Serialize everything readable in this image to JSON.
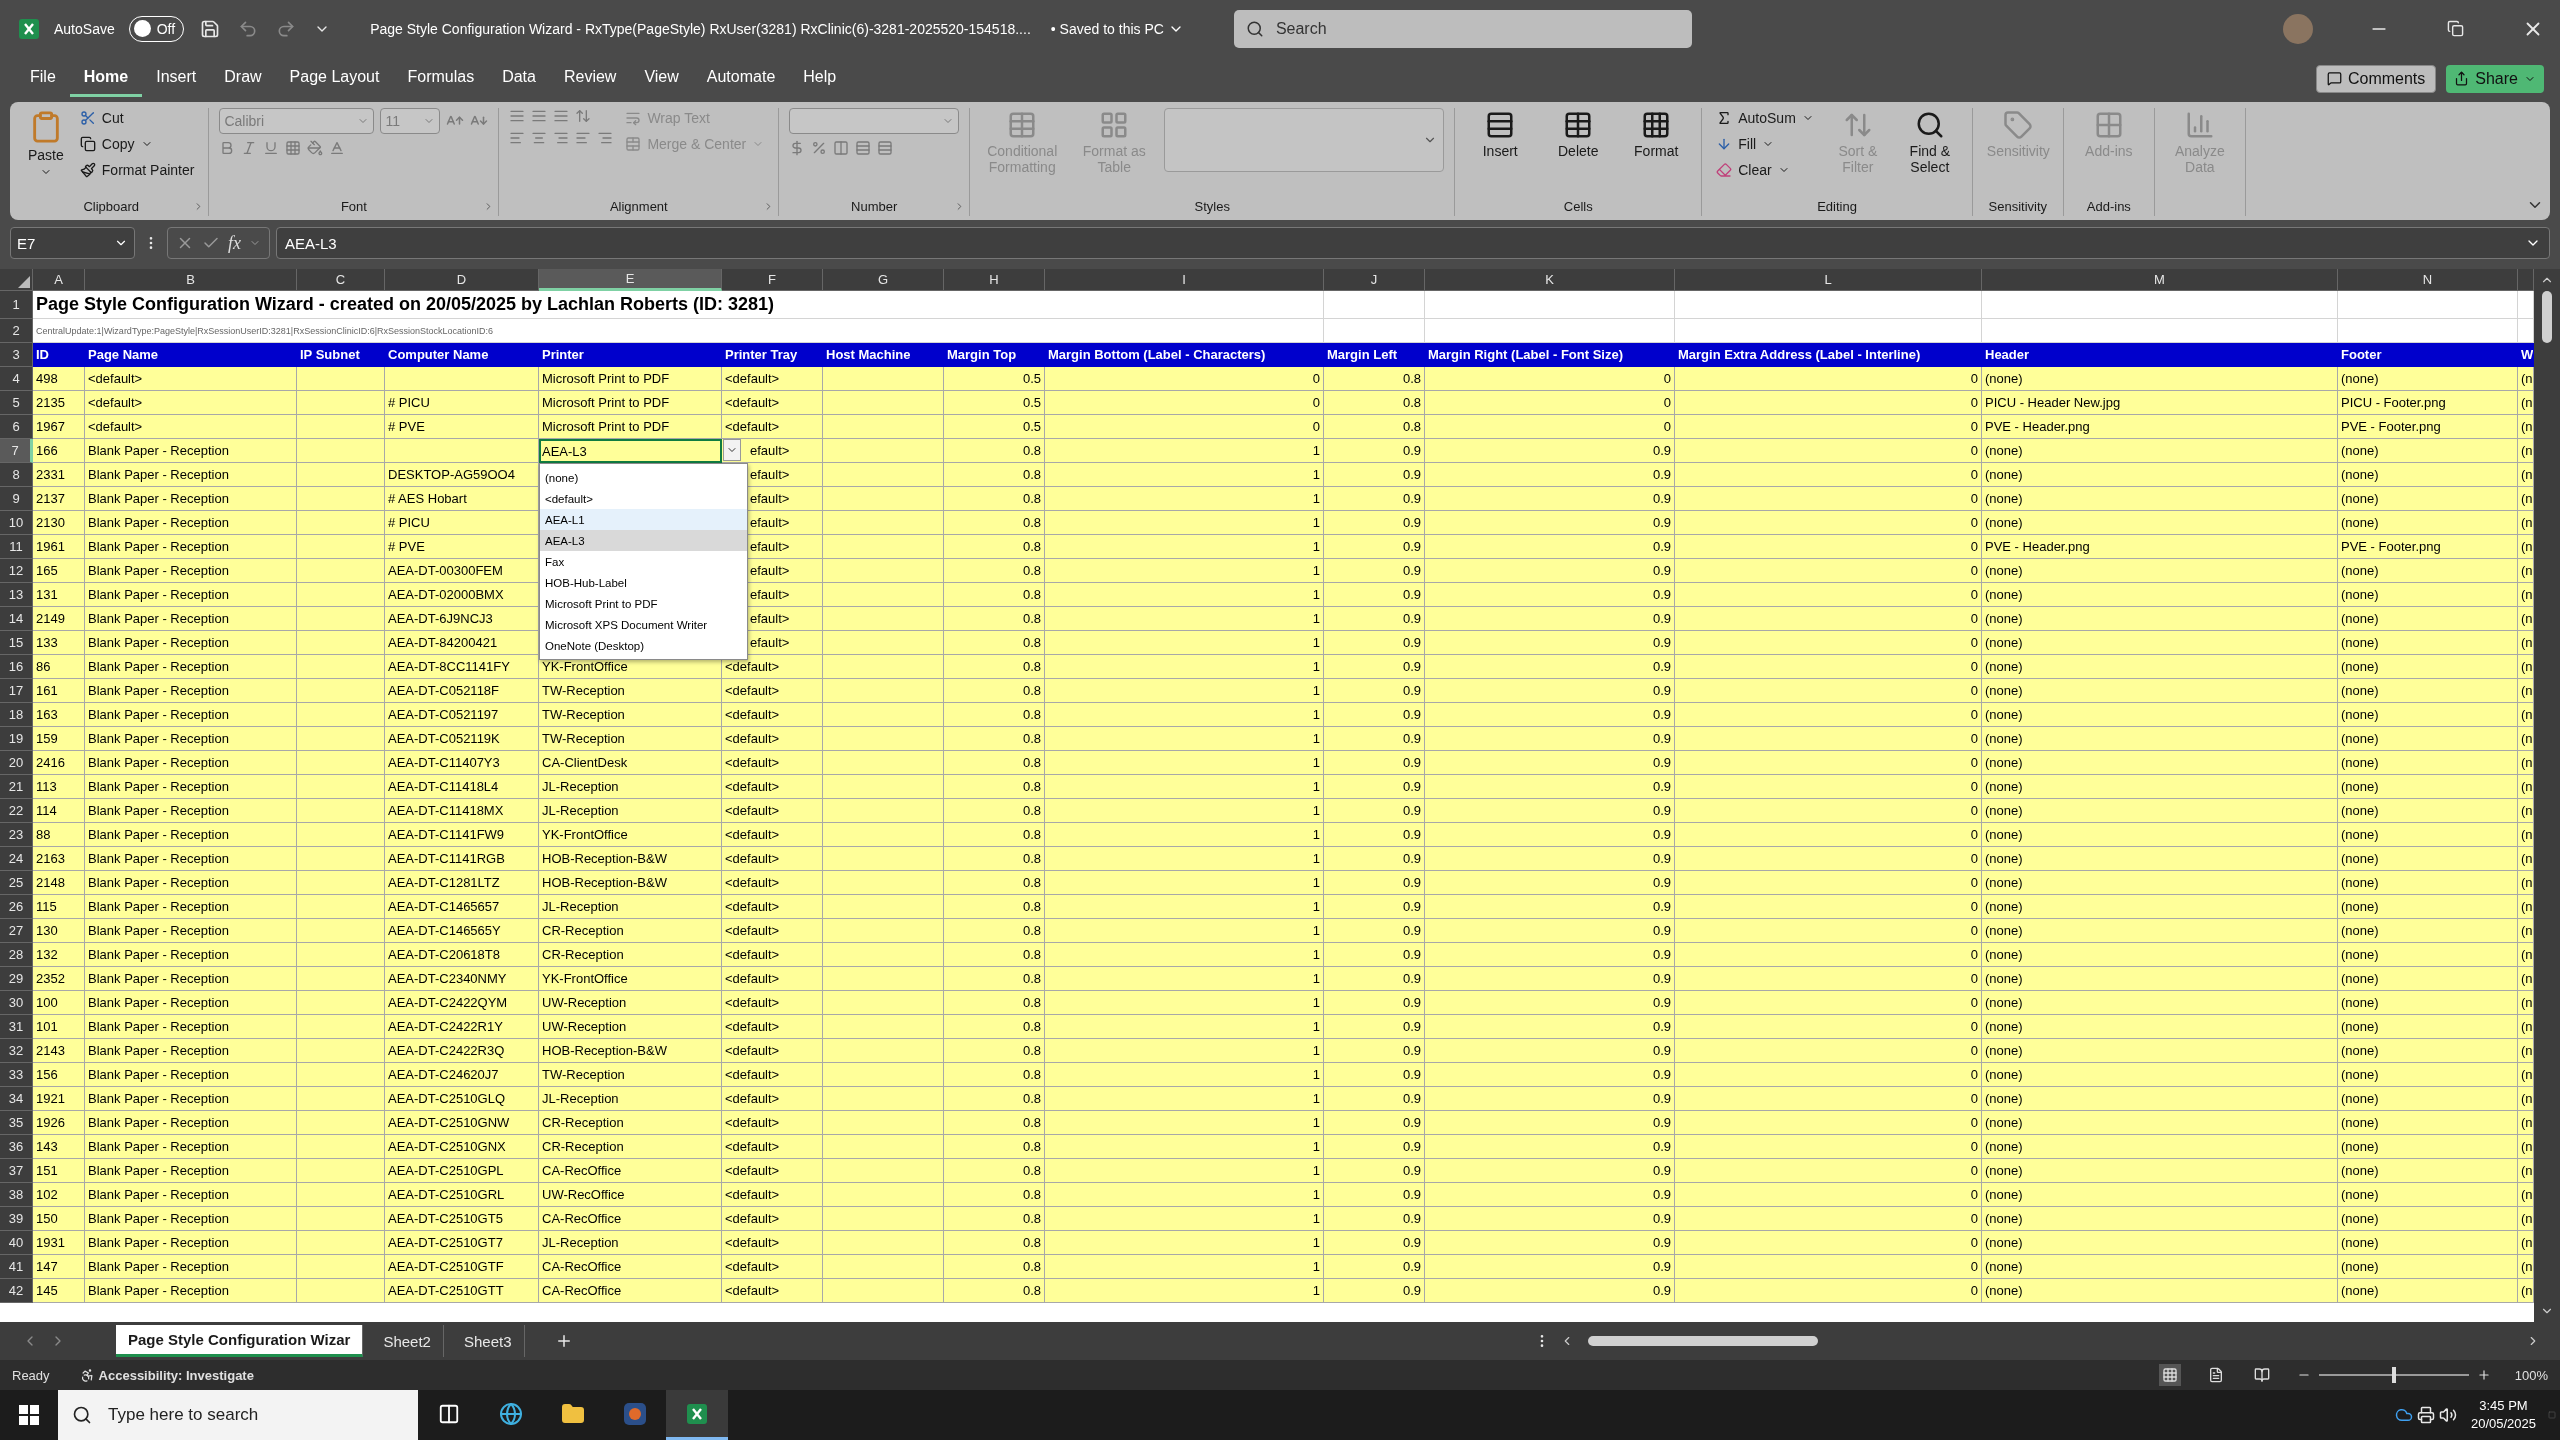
{
  "titlebar": {
    "autosave_label": "AutoSave",
    "autosave": {
      "on": false,
      "label": "Off"
    },
    "title": "Page Style Configuration Wizard - RxType(PageStyle) RxUser(3281) RxClinic(6)-3281-2025520-154518....",
    "save_status": "• Saved to this PC",
    "search": {
      "placeholder": "Search"
    }
  },
  "menu": {
    "tabs": [
      {
        "label": "File",
        "selected": false
      },
      {
        "label": "Home",
        "selected": true
      },
      {
        "label": "Insert",
        "selected": false
      },
      {
        "label": "Draw",
        "selected": false
      },
      {
        "label": "Page Layout",
        "selected": false
      },
      {
        "label": "Formulas",
        "selected": false
      },
      {
        "label": "Data",
        "selected": false
      },
      {
        "label": "Review",
        "selected": false
      },
      {
        "label": "View",
        "selected": false
      },
      {
        "label": "Automate",
        "selected": false
      },
      {
        "label": "Help",
        "selected": false
      }
    ],
    "comments": "Comments",
    "share": "Share"
  },
  "ribbon": {
    "groups": [
      {
        "kind": "clipboard",
        "label": "Clipboard",
        "launcher": true,
        "items": [
          {
            "label": "Paste",
            "disabled": false
          },
          {
            "label": "Cut",
            "disabled": false
          },
          {
            "label": "Copy",
            "disabled": false
          },
          {
            "label": "Format Painter",
            "disabled": false
          }
        ]
      },
      {
        "kind": "font",
        "label": "Font",
        "launcher": true,
        "font_name": "Calibri",
        "font_size": "11"
      },
      {
        "kind": "alignment",
        "label": "Alignment",
        "launcher": true,
        "items": [
          {
            "label": "Wrap Text",
            "disabled": true
          },
          {
            "label": "Merge & Center",
            "disabled": true
          }
        ]
      },
      {
        "kind": "number",
        "label": "Number",
        "launcher": true
      },
      {
        "kind": "styles",
        "label": "Styles",
        "items": [
          {
            "label": "Conditional Formatting",
            "disabled": true
          },
          {
            "label": "Format as Table",
            "disabled": true
          }
        ]
      },
      {
        "kind": "large",
        "label": "Cells",
        "items": [
          {
            "label": "Insert",
            "disabled": false
          },
          {
            "label": "Delete",
            "disabled": false
          },
          {
            "label": "Format",
            "disabled": false
          }
        ]
      },
      {
        "kind": "editing",
        "label": "Editing",
        "items": [
          {
            "label": "AutoSum",
            "disabled": false
          },
          {
            "label": "Fill",
            "disabled": false
          },
          {
            "label": "Clear",
            "disabled": false
          },
          {
            "label": "Sort & Filter",
            "disabled": true
          },
          {
            "label": "Find & Select",
            "disabled": false
          }
        ]
      },
      {
        "kind": "large",
        "label": "Sensitivity",
        "items": [
          {
            "label": "Sensitivity",
            "disabled": true
          }
        ]
      },
      {
        "kind": "large",
        "label": "Add-ins",
        "items": [
          {
            "label": "Add-ins",
            "disabled": true
          }
        ]
      },
      {
        "kind": "large",
        "items": [
          {
            "label": "Analyze Data",
            "disabled": true
          }
        ]
      }
    ]
  },
  "formula_bar": {
    "name_box": "E7",
    "function_label": "fx",
    "value": "AEA-L3"
  },
  "sheet": {
    "columns": [
      {
        "letter": "A",
        "header": "ID",
        "kind": "text",
        "selected": false
      },
      {
        "letter": "B",
        "header": "Page Name",
        "kind": "text",
        "selected": false
      },
      {
        "letter": "C",
        "header": "IP Subnet",
        "kind": "text",
        "selected": false
      },
      {
        "letter": "D",
        "header": "Computer Name",
        "kind": "text",
        "selected": false
      },
      {
        "letter": "E",
        "header": "Printer",
        "kind": "text",
        "selected": true
      },
      {
        "letter": "F",
        "header": "Printer Tray",
        "kind": "text",
        "selected": false
      },
      {
        "letter": "G",
        "header": "Host Machine",
        "kind": "text",
        "selected": false
      },
      {
        "letter": "H",
        "header": "Margin Top",
        "kind": "number",
        "selected": false
      },
      {
        "letter": "I",
        "header": "Margin Bottom (Label - Characters)",
        "kind": "number",
        "selected": false
      },
      {
        "letter": "J",
        "header": "Margin Left",
        "kind": "number",
        "selected": false
      },
      {
        "letter": "K",
        "header": "Margin Right (Label - Font Size)",
        "kind": "number",
        "selected": false
      },
      {
        "letter": "L",
        "header": "Margin Extra Address (Label - Interline)",
        "kind": "number",
        "selected": false
      },
      {
        "letter": "M",
        "header": "Header",
        "kind": "text",
        "selected": false
      },
      {
        "letter": "N",
        "header": "Footer",
        "kind": "text",
        "selected": false
      },
      {
        "header": "W",
        "kind": "text",
        "selected": false
      }
    ],
    "title_row": {
      "number": "1",
      "text": "Page Style Configuration Wizard - created on 20/05/2025 by Lachlan Roberts (ID: 3281)"
    },
    "info_row": {
      "number": "2",
      "text": "CentralUpdate:1|WizardType:PageStyle|RxSessionUserID:3281|RxSessionClinicID:6|RxSessionStockLocationID:6"
    },
    "header_row_number": "3",
    "rows": [
      {
        "number": "4",
        "selected": false,
        "cells": [
          "498",
          "<default>",
          null,
          null,
          "Microsoft Print to PDF",
          "<default>",
          null,
          "0.5",
          "0",
          "0.8",
          "0",
          "0",
          "(none)",
          "(none)",
          "(n"
        ]
      },
      {
        "number": "5",
        "selected": false,
        "cells": [
          "2135",
          "<default>",
          null,
          "# PICU",
          "Microsoft Print to PDF",
          "<default>",
          null,
          "0.5",
          "0",
          "0.8",
          "0",
          "0",
          "PICU - Header New.jpg",
          "PICU - Footer.png",
          "(n"
        ]
      },
      {
        "number": "6",
        "selected": false,
        "cells": [
          "1967",
          "<default>",
          null,
          "# PVE",
          "Microsoft Print to PDF",
          "<default>",
          null,
          "0.5",
          "0",
          "0.8",
          "0",
          "0",
          "PVE - Header.png",
          "PVE - Footer.png",
          "(n"
        ]
      },
      {
        "number": "7",
        "selected": true,
        "cells": [
          "166",
          "Blank Paper - Reception",
          null,
          null,
          "AEA-L3",
          "efault>",
          null,
          "0.8",
          "1",
          "0.9",
          "0.9",
          "0",
          "(none)",
          "(none)",
          "(n"
        ]
      },
      {
        "number": "8",
        "selected": false,
        "cells": [
          "2331",
          "Blank Paper - Reception",
          null,
          "DESKTOP-AG59OO4",
          null,
          "efault>",
          null,
          "0.8",
          "1",
          "0.9",
          "0.9",
          "0",
          "(none)",
          "(none)",
          "(n"
        ]
      },
      {
        "number": "9",
        "selected": false,
        "cells": [
          "2137",
          "Blank Paper - Reception",
          null,
          "# AES Hobart",
          null,
          "efault>",
          null,
          "0.8",
          "1",
          "0.9",
          "0.9",
          "0",
          "(none)",
          "(none)",
          "(n"
        ]
      },
      {
        "number": "10",
        "selected": false,
        "cells": [
          "2130",
          "Blank Paper - Reception",
          null,
          "# PICU",
          null,
          "efault>",
          null,
          "0.8",
          "1",
          "0.9",
          "0.9",
          "0",
          "(none)",
          "(none)",
          "(n"
        ]
      },
      {
        "number": "11",
        "selected": false,
        "cells": [
          "1961",
          "Blank Paper - Reception",
          null,
          "# PVE",
          null,
          "efault>",
          null,
          "0.8",
          "1",
          "0.9",
          "0.9",
          "0",
          "PVE - Header.png",
          "PVE - Footer.png",
          "(n"
        ]
      },
      {
        "number": "12",
        "selected": false,
        "cells": [
          "165",
          "Blank Paper - Reception",
          null,
          "AEA-DT-00300FEM",
          null,
          "efault>",
          null,
          "0.8",
          "1",
          "0.9",
          "0.9",
          "0",
          "(none)",
          "(none)",
          "(n"
        ]
      },
      {
        "number": "13",
        "selected": false,
        "cells": [
          "131",
          "Blank Paper - Reception",
          null,
          "AEA-DT-02000BMX",
          null,
          "efault>",
          null,
          "0.8",
          "1",
          "0.9",
          "0.9",
          "0",
          "(none)",
          "(none)",
          "(n"
        ]
      },
      {
        "number": "14",
        "selected": false,
        "cells": [
          "2149",
          "Blank Paper - Reception",
          null,
          "AEA-DT-6J9NCJ3",
          null,
          "efault>",
          null,
          "0.8",
          "1",
          "0.9",
          "0.9",
          "0",
          "(none)",
          "(none)",
          "(n"
        ]
      },
      {
        "number": "15",
        "selected": false,
        "cells": [
          "133",
          "Blank Paper - Reception",
          null,
          "AEA-DT-84200421",
          null,
          "efault>",
          null,
          "0.8",
          "1",
          "0.9",
          "0.9",
          "0",
          "(none)",
          "(none)",
          "(n"
        ]
      },
      {
        "number": "16",
        "selected": false,
        "cells": [
          "86",
          "Blank Paper - Reception",
          null,
          "AEA-DT-8CC1141FY",
          "YK-FrontOffice",
          "<default>",
          null,
          "0.8",
          "1",
          "0.9",
          "0.9",
          "0",
          "(none)",
          "(none)",
          "(n"
        ]
      },
      {
        "number": "17",
        "selected": false,
        "cells": [
          "161",
          "Blank Paper - Reception",
          null,
          "AEA-DT-C052118F",
          "TW-Reception",
          "<default>",
          null,
          "0.8",
          "1",
          "0.9",
          "0.9",
          "0",
          "(none)",
          "(none)",
          "(n"
        ]
      },
      {
        "number": "18",
        "selected": false,
        "cells": [
          "163",
          "Blank Paper - Reception",
          null,
          "AEA-DT-C0521197",
          "TW-Reception",
          "<default>",
          null,
          "0.8",
          "1",
          "0.9",
          "0.9",
          "0",
          "(none)",
          "(none)",
          "(n"
        ]
      },
      {
        "number": "19",
        "selected": false,
        "cells": [
          "159",
          "Blank Paper - Reception",
          null,
          "AEA-DT-C052119K",
          "TW-Reception",
          "<default>",
          null,
          "0.8",
          "1",
          "0.9",
          "0.9",
          "0",
          "(none)",
          "(none)",
          "(n"
        ]
      },
      {
        "number": "20",
        "selected": false,
        "cells": [
          "2416",
          "Blank Paper - Reception",
          null,
          "AEA-DT-C11407Y3",
          "CA-ClientDesk",
          "<default>",
          null,
          "0.8",
          "1",
          "0.9",
          "0.9",
          "0",
          "(none)",
          "(none)",
          "(n"
        ]
      },
      {
        "number": "21",
        "selected": false,
        "cells": [
          "113",
          "Blank Paper - Reception",
          null,
          "AEA-DT-C11418L4",
          "JL-Reception",
          "<default>",
          null,
          "0.8",
          "1",
          "0.9",
          "0.9",
          "0",
          "(none)",
          "(none)",
          "(n"
        ]
      },
      {
        "number": "22",
        "selected": false,
        "cells": [
          "114",
          "Blank Paper - Reception",
          null,
          "AEA-DT-C11418MX",
          "JL-Reception",
          "<default>",
          null,
          "0.8",
          "1",
          "0.9",
          "0.9",
          "0",
          "(none)",
          "(none)",
          "(n"
        ]
      },
      {
        "number": "23",
        "selected": false,
        "cells": [
          "88",
          "Blank Paper - Reception",
          null,
          "AEA-DT-C1141FW9",
          "YK-FrontOffice",
          "<default>",
          null,
          "0.8",
          "1",
          "0.9",
          "0.9",
          "0",
          "(none)",
          "(none)",
          "(n"
        ]
      },
      {
        "number": "24",
        "selected": false,
        "cells": [
          "2163",
          "Blank Paper - Reception",
          null,
          "AEA-DT-C1141RGB",
          "HOB-Reception-B&W",
          "<default>",
          null,
          "0.8",
          "1",
          "0.9",
          "0.9",
          "0",
          "(none)",
          "(none)",
          "(n"
        ]
      },
      {
        "number": "25",
        "selected": false,
        "cells": [
          "2148",
          "Blank Paper - Reception",
          null,
          "AEA-DT-C1281LTZ",
          "HOB-Reception-B&W",
          "<default>",
          null,
          "0.8",
          "1",
          "0.9",
          "0.9",
          "0",
          "(none)",
          "(none)",
          "(n"
        ]
      },
      {
        "number": "26",
        "selected": false,
        "cells": [
          "115",
          "Blank Paper - Reception",
          null,
          "AEA-DT-C1465657",
          "JL-Reception",
          "<default>",
          null,
          "0.8",
          "1",
          "0.9",
          "0.9",
          "0",
          "(none)",
          "(none)",
          "(n"
        ]
      },
      {
        "number": "27",
        "selected": false,
        "cells": [
          "130",
          "Blank Paper - Reception",
          null,
          "AEA-DT-C146565Y",
          "CR-Reception",
          "<default>",
          null,
          "0.8",
          "1",
          "0.9",
          "0.9",
          "0",
          "(none)",
          "(none)",
          "(n"
        ]
      },
      {
        "number": "28",
        "selected": false,
        "cells": [
          "132",
          "Blank Paper - Reception",
          null,
          "AEA-DT-C20618T8",
          "CR-Reception",
          "<default>",
          null,
          "0.8",
          "1",
          "0.9",
          "0.9",
          "0",
          "(none)",
          "(none)",
          "(n"
        ]
      },
      {
        "number": "29",
        "selected": false,
        "cells": [
          "2352",
          "Blank Paper - Reception",
          null,
          "AEA-DT-C2340NMY",
          "YK-FrontOffice",
          "<default>",
          null,
          "0.8",
          "1",
          "0.9",
          "0.9",
          "0",
          "(none)",
          "(none)",
          "(n"
        ]
      },
      {
        "number": "30",
        "selected": false,
        "cells": [
          "100",
          "Blank Paper - Reception",
          null,
          "AEA-DT-C2422QYM",
          "UW-Reception",
          "<default>",
          null,
          "0.8",
          "1",
          "0.9",
          "0.9",
          "0",
          "(none)",
          "(none)",
          "(n"
        ]
      },
      {
        "number": "31",
        "selected": false,
        "cells": [
          "101",
          "Blank Paper - Reception",
          null,
          "AEA-DT-C2422R1Y",
          "UW-Reception",
          "<default>",
          null,
          "0.8",
          "1",
          "0.9",
          "0.9",
          "0",
          "(none)",
          "(none)",
          "(n"
        ]
      },
      {
        "number": "32",
        "selected": false,
        "cells": [
          "2143",
          "Blank Paper - Reception",
          null,
          "AEA-DT-C2422R3Q",
          "HOB-Reception-B&W",
          "<default>",
          null,
          "0.8",
          "1",
          "0.9",
          "0.9",
          "0",
          "(none)",
          "(none)",
          "(n"
        ]
      },
      {
        "number": "33",
        "selected": false,
        "cells": [
          "156",
          "Blank Paper - Reception",
          null,
          "AEA-DT-C24620J7",
          "TW-Reception",
          "<default>",
          null,
          "0.8",
          "1",
          "0.9",
          "0.9",
          "0",
          "(none)",
          "(none)",
          "(n"
        ]
      },
      {
        "number": "34",
        "selected": false,
        "cells": [
          "1921",
          "Blank Paper - Reception",
          null,
          "AEA-DT-C2510GLQ",
          "JL-Reception",
          "<default>",
          null,
          "0.8",
          "1",
          "0.9",
          "0.9",
          "0",
          "(none)",
          "(none)",
          "(n"
        ]
      },
      {
        "number": "35",
        "selected": false,
        "cells": [
          "1926",
          "Blank Paper - Reception",
          null,
          "AEA-DT-C2510GNW",
          "CR-Reception",
          "<default>",
          null,
          "0.8",
          "1",
          "0.9",
          "0.9",
          "0",
          "(none)",
          "(none)",
          "(n"
        ]
      },
      {
        "number": "36",
        "selected": false,
        "cells": [
          "143",
          "Blank Paper - Reception",
          null,
          "AEA-DT-C2510GNX",
          "CR-Reception",
          "<default>",
          null,
          "0.8",
          "1",
          "0.9",
          "0.9",
          "0",
          "(none)",
          "(none)",
          "(n"
        ]
      },
      {
        "number": "37",
        "selected": false,
        "cells": [
          "151",
          "Blank Paper - Reception",
          null,
          "AEA-DT-C2510GPL",
          "CA-RecOffice",
          "<default>",
          null,
          "0.8",
          "1",
          "0.9",
          "0.9",
          "0",
          "(none)",
          "(none)",
          "(n"
        ]
      },
      {
        "number": "38",
        "selected": false,
        "cells": [
          "102",
          "Blank Paper - Reception",
          null,
          "AEA-DT-C2510GRL",
          "UW-RecOffice",
          "<default>",
          null,
          "0.8",
          "1",
          "0.9",
          "0.9",
          "0",
          "(none)",
          "(none)",
          "(n"
        ]
      },
      {
        "number": "39",
        "selected": false,
        "cells": [
          "150",
          "Blank Paper - Reception",
          null,
          "AEA-DT-C2510GT5",
          "CA-RecOffice",
          "<default>",
          null,
          "0.8",
          "1",
          "0.9",
          "0.9",
          "0",
          "(none)",
          "(none)",
          "(n"
        ]
      },
      {
        "number": "40",
        "selected": false,
        "cells": [
          "1931",
          "Blank Paper - Reception",
          null,
          "AEA-DT-C2510GT7",
          "JL-Reception",
          "<default>",
          null,
          "0.8",
          "1",
          "0.9",
          "0.9",
          "0",
          "(none)",
          "(none)",
          "(n"
        ]
      },
      {
        "number": "41",
        "selected": false,
        "cells": [
          "147",
          "Blank Paper - Reception",
          null,
          "AEA-DT-C2510GTF",
          "CA-RecOffice",
          "<default>",
          null,
          "0.8",
          "1",
          "0.9",
          "0.9",
          "0",
          "(none)",
          "(none)",
          "(n"
        ]
      },
      {
        "number": "42",
        "selected": false,
        "cells": [
          "145",
          "Blank Paper - Reception",
          null,
          "AEA-DT-C2510GTT",
          "CA-RecOffice",
          "<default>",
          null,
          "0.8",
          "1",
          "0.9",
          "0.9",
          "0",
          "(none)",
          "(none)",
          "(n"
        ]
      }
    ],
    "dropdown": {
      "items": [
        {
          "label": "(none)",
          "selected": false,
          "hovered": false
        },
        {
          "label": "<default>",
          "selected": false,
          "hovered": false
        },
        {
          "label": "AEA-L1",
          "selected": false,
          "hovered": true
        },
        {
          "label": "AEA-L3",
          "selected": true,
          "hovered": false
        },
        {
          "label": "Fax",
          "selected": false,
          "hovered": false
        },
        {
          "label": "HOB-Hub-Label",
          "selected": false,
          "hovered": false
        },
        {
          "label": "Microsoft Print to PDF",
          "selected": false,
          "hovered": false
        },
        {
          "label": "Microsoft XPS Document Writer",
          "selected": false,
          "hovered": false
        },
        {
          "label": "OneNote (Desktop)",
          "selected": false,
          "hovered": false
        }
      ]
    }
  },
  "sheet_tabs": {
    "tabs": [
      {
        "label": "Page Style Configuration Wizar",
        "selected": true
      },
      {
        "label": "Sheet2",
        "selected": false
      },
      {
        "label": "Sheet3",
        "selected": false
      }
    ]
  },
  "status_bar": {
    "status": "Ready",
    "accessibility": "Accessibility: Investigate",
    "views": [
      {
        "kind": "normal",
        "selected": true
      },
      {
        "kind": "layout",
        "selected": false
      },
      {
        "kind": "break",
        "selected": false
      }
    ],
    "zoom": {
      "level": 0.5,
      "reading": "100%"
    }
  },
  "taskbar": {
    "search": {
      "placeholder": "Type here to search"
    },
    "apps": [
      {
        "kind": "taskview",
        "active": false
      },
      {
        "kind": "browser",
        "active": false
      },
      {
        "kind": "folder",
        "active": false
      },
      {
        "kind": "rx",
        "active": false
      },
      {
        "kind": "excel",
        "active": true
      }
    ],
    "time": "3:45 PM",
    "date": "20/05/2025"
  }
}
